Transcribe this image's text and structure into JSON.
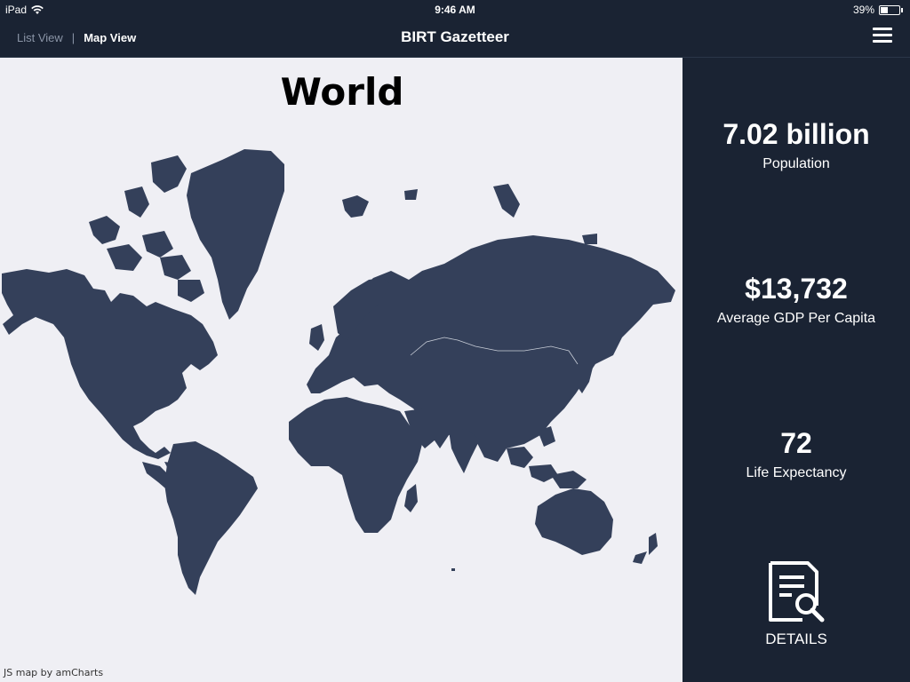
{
  "status_bar": {
    "device": "iPad",
    "time": "9:46 AM",
    "battery_text": "39%",
    "battery_level": 0.39
  },
  "nav": {
    "list_view": "List View",
    "separator": "|",
    "map_view": "Map View",
    "title": "BIRT Gazetteer",
    "menu_icon": "hamburger-menu-icon"
  },
  "map": {
    "title": "World",
    "credit": "JS map by amCharts",
    "land_color": "#34405a",
    "ocean_color": "#efeff4"
  },
  "stats": [
    {
      "value": "7.02 billion",
      "label": "Population"
    },
    {
      "value": "$13,732",
      "label": "Average GDP Per Capita"
    },
    {
      "value": "72",
      "label": "Life Expectancy"
    }
  ],
  "details": {
    "label": "DETAILS",
    "icon": "document-search-icon"
  }
}
